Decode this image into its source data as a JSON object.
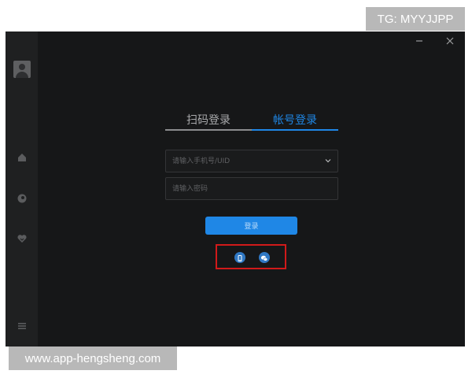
{
  "overlay": {
    "tg_badge": "TG: MYYJJPP",
    "watermark": "www.app-hengsheng.com"
  },
  "window": {
    "minimize_icon": "minimize-icon",
    "close_icon": "close-icon"
  },
  "sidebar": {
    "avatar_icon": "user-avatar-icon",
    "items": [
      {
        "icon": "home-icon"
      },
      {
        "icon": "circle-icon"
      },
      {
        "icon": "heart-icon"
      }
    ],
    "menu_icon": "hamburger-menu-icon"
  },
  "login": {
    "tabs": [
      {
        "label": "扫码登录",
        "active": false
      },
      {
        "label": "帐号登录",
        "active": true
      }
    ],
    "account_placeholder": "请输入手机号/UID",
    "password_placeholder": "请输入密码",
    "submit_label": "登录",
    "third_party": [
      {
        "icon": "phone-icon"
      },
      {
        "icon": "wechat-icon"
      }
    ]
  },
  "colors": {
    "accent": "#1f87e6",
    "background": "#161718",
    "sidebar": "#1f2021",
    "highlight_box": "#d11a1a"
  }
}
